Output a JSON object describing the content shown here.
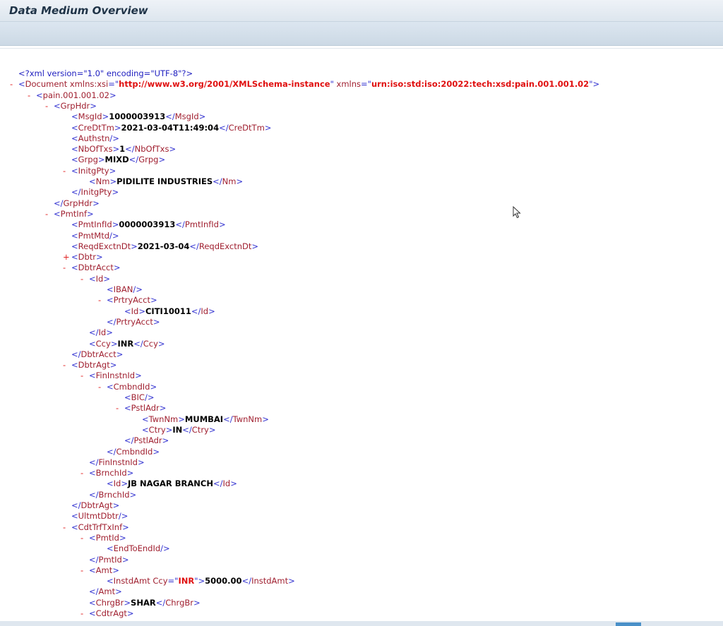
{
  "window": {
    "title": "Data Medium Overview"
  },
  "xml_lines": [
    {
      "indent": 0,
      "toggle": "",
      "parts": [
        [
          "pi",
          "<?xml version=\"1.0\" encoding=\"UTF-8\"?>"
        ]
      ]
    },
    {
      "indent": 0,
      "toggle": "-",
      "parts": [
        [
          "tag",
          "<"
        ],
        [
          "tagname",
          "Document"
        ],
        [
          "attr",
          " xmlns:xsi"
        ],
        [
          "tag",
          "=\""
        ],
        [
          "attrval",
          "http://www.w3.org/2001/XMLSchema-instance"
        ],
        [
          "tag",
          "\""
        ],
        [
          "attr",
          " xmlns"
        ],
        [
          "tag",
          "=\""
        ],
        [
          "attrval",
          "urn:iso:std:iso:20022:tech:xsd:pain.001.001.02"
        ],
        [
          "tag",
          "\">"
        ]
      ]
    },
    {
      "indent": 1,
      "toggle": "-",
      "parts": [
        [
          "tag",
          "<"
        ],
        [
          "tagname",
          "pain.001.001.02"
        ],
        [
          "tag",
          ">"
        ]
      ]
    },
    {
      "indent": 2,
      "toggle": "-",
      "parts": [
        [
          "tag",
          "<"
        ],
        [
          "tagname",
          "GrpHdr"
        ],
        [
          "tag",
          ">"
        ]
      ]
    },
    {
      "indent": 3,
      "toggle": "",
      "parts": [
        [
          "tag",
          "<"
        ],
        [
          "tagname",
          "MsgId"
        ],
        [
          "tag",
          ">"
        ],
        [
          "val",
          "1000003913"
        ],
        [
          "tag",
          "</"
        ],
        [
          "tagname",
          "MsgId"
        ],
        [
          "tag",
          ">"
        ]
      ]
    },
    {
      "indent": 3,
      "toggle": "",
      "parts": [
        [
          "tag",
          "<"
        ],
        [
          "tagname",
          "CreDtTm"
        ],
        [
          "tag",
          ">"
        ],
        [
          "val",
          "2021-03-04T11:49:04"
        ],
        [
          "tag",
          "</"
        ],
        [
          "tagname",
          "CreDtTm"
        ],
        [
          "tag",
          ">"
        ]
      ]
    },
    {
      "indent": 3,
      "toggle": "",
      "parts": [
        [
          "tag",
          "<"
        ],
        [
          "tagname",
          "Authstn"
        ],
        [
          "tag",
          "/>"
        ]
      ]
    },
    {
      "indent": 3,
      "toggle": "",
      "parts": [
        [
          "tag",
          "<"
        ],
        [
          "tagname",
          "NbOfTxs"
        ],
        [
          "tag",
          ">"
        ],
        [
          "val",
          "1"
        ],
        [
          "tag",
          "</"
        ],
        [
          "tagname",
          "NbOfTxs"
        ],
        [
          "tag",
          ">"
        ]
      ]
    },
    {
      "indent": 3,
      "toggle": "",
      "parts": [
        [
          "tag",
          "<"
        ],
        [
          "tagname",
          "Grpg"
        ],
        [
          "tag",
          ">"
        ],
        [
          "val",
          "MIXD"
        ],
        [
          "tag",
          "</"
        ],
        [
          "tagname",
          "Grpg"
        ],
        [
          "tag",
          ">"
        ]
      ]
    },
    {
      "indent": 3,
      "toggle": "-",
      "parts": [
        [
          "tag",
          "<"
        ],
        [
          "tagname",
          "InitgPty"
        ],
        [
          "tag",
          ">"
        ]
      ]
    },
    {
      "indent": 4,
      "toggle": "",
      "parts": [
        [
          "tag",
          "<"
        ],
        [
          "tagname",
          "Nm"
        ],
        [
          "tag",
          ">"
        ],
        [
          "val",
          "PIDILITE INDUSTRIES"
        ],
        [
          "tag",
          "</"
        ],
        [
          "tagname",
          "Nm"
        ],
        [
          "tag",
          ">"
        ]
      ]
    },
    {
      "indent": 3,
      "toggle": "",
      "parts": [
        [
          "tag",
          "</"
        ],
        [
          "tagname",
          "InitgPty"
        ],
        [
          "tag",
          ">"
        ]
      ]
    },
    {
      "indent": 2,
      "toggle": "",
      "parts": [
        [
          "tag",
          "</"
        ],
        [
          "tagname",
          "GrpHdr"
        ],
        [
          "tag",
          ">"
        ]
      ]
    },
    {
      "indent": 2,
      "toggle": "-",
      "parts": [
        [
          "tag",
          "<"
        ],
        [
          "tagname",
          "PmtInf"
        ],
        [
          "tag",
          ">"
        ]
      ]
    },
    {
      "indent": 3,
      "toggle": "",
      "parts": [
        [
          "tag",
          "<"
        ],
        [
          "tagname",
          "PmtInfId"
        ],
        [
          "tag",
          ">"
        ],
        [
          "val",
          "0000003913"
        ],
        [
          "tag",
          "</"
        ],
        [
          "tagname",
          "PmtInfId"
        ],
        [
          "tag",
          ">"
        ]
      ]
    },
    {
      "indent": 3,
      "toggle": "",
      "parts": [
        [
          "tag",
          "<"
        ],
        [
          "tagname",
          "PmtMtd"
        ],
        [
          "tag",
          "/>"
        ]
      ]
    },
    {
      "indent": 3,
      "toggle": "",
      "parts": [
        [
          "tag",
          "<"
        ],
        [
          "tagname",
          "ReqdExctnDt"
        ],
        [
          "tag",
          ">"
        ],
        [
          "val",
          "2021-03-04"
        ],
        [
          "tag",
          "</"
        ],
        [
          "tagname",
          "ReqdExctnDt"
        ],
        [
          "tag",
          ">"
        ]
      ]
    },
    {
      "indent": 3,
      "toggle": "+",
      "parts": [
        [
          "tag",
          "<"
        ],
        [
          "tagname",
          "Dbtr"
        ],
        [
          "tag",
          ">"
        ]
      ]
    },
    {
      "indent": 3,
      "toggle": "-",
      "parts": [
        [
          "tag",
          "<"
        ],
        [
          "tagname",
          "DbtrAcct"
        ],
        [
          "tag",
          ">"
        ]
      ]
    },
    {
      "indent": 4,
      "toggle": "-",
      "parts": [
        [
          "tag",
          "<"
        ],
        [
          "tagname",
          "Id"
        ],
        [
          "tag",
          ">"
        ]
      ]
    },
    {
      "indent": 5,
      "toggle": "",
      "parts": [
        [
          "tag",
          "<"
        ],
        [
          "tagname",
          "IBAN"
        ],
        [
          "tag",
          "/>"
        ]
      ]
    },
    {
      "indent": 5,
      "toggle": "-",
      "parts": [
        [
          "tag",
          "<"
        ],
        [
          "tagname",
          "PrtryAcct"
        ],
        [
          "tag",
          ">"
        ]
      ]
    },
    {
      "indent": 6,
      "toggle": "",
      "parts": [
        [
          "tag",
          "<"
        ],
        [
          "tagname",
          "Id"
        ],
        [
          "tag",
          ">"
        ],
        [
          "val",
          "CITI10011"
        ],
        [
          "tag",
          "</"
        ],
        [
          "tagname",
          "Id"
        ],
        [
          "tag",
          ">"
        ]
      ]
    },
    {
      "indent": 5,
      "toggle": "",
      "parts": [
        [
          "tag",
          "</"
        ],
        [
          "tagname",
          "PrtryAcct"
        ],
        [
          "tag",
          ">"
        ]
      ]
    },
    {
      "indent": 4,
      "toggle": "",
      "parts": [
        [
          "tag",
          "</"
        ],
        [
          "tagname",
          "Id"
        ],
        [
          "tag",
          ">"
        ]
      ]
    },
    {
      "indent": 4,
      "toggle": "",
      "parts": [
        [
          "tag",
          "<"
        ],
        [
          "tagname",
          "Ccy"
        ],
        [
          "tag",
          ">"
        ],
        [
          "val",
          "INR"
        ],
        [
          "tag",
          "</"
        ],
        [
          "tagname",
          "Ccy"
        ],
        [
          "tag",
          ">"
        ]
      ]
    },
    {
      "indent": 3,
      "toggle": "",
      "parts": [
        [
          "tag",
          "</"
        ],
        [
          "tagname",
          "DbtrAcct"
        ],
        [
          "tag",
          ">"
        ]
      ]
    },
    {
      "indent": 3,
      "toggle": "-",
      "parts": [
        [
          "tag",
          "<"
        ],
        [
          "tagname",
          "DbtrAgt"
        ],
        [
          "tag",
          ">"
        ]
      ]
    },
    {
      "indent": 4,
      "toggle": "-",
      "parts": [
        [
          "tag",
          "<"
        ],
        [
          "tagname",
          "FinInstnId"
        ],
        [
          "tag",
          ">"
        ]
      ]
    },
    {
      "indent": 5,
      "toggle": "-",
      "parts": [
        [
          "tag",
          "<"
        ],
        [
          "tagname",
          "CmbndId"
        ],
        [
          "tag",
          ">"
        ]
      ]
    },
    {
      "indent": 6,
      "toggle": "",
      "parts": [
        [
          "tag",
          "<"
        ],
        [
          "tagname",
          "BIC"
        ],
        [
          "tag",
          "/>"
        ]
      ]
    },
    {
      "indent": 6,
      "toggle": "-",
      "parts": [
        [
          "tag",
          "<"
        ],
        [
          "tagname",
          "PstlAdr"
        ],
        [
          "tag",
          ">"
        ]
      ]
    },
    {
      "indent": 7,
      "toggle": "",
      "parts": [
        [
          "tag",
          "<"
        ],
        [
          "tagname",
          "TwnNm"
        ],
        [
          "tag",
          ">"
        ],
        [
          "val",
          "MUMBAI"
        ],
        [
          "tag",
          "</"
        ],
        [
          "tagname",
          "TwnNm"
        ],
        [
          "tag",
          ">"
        ]
      ]
    },
    {
      "indent": 7,
      "toggle": "",
      "parts": [
        [
          "tag",
          "<"
        ],
        [
          "tagname",
          "Ctry"
        ],
        [
          "tag",
          ">"
        ],
        [
          "val",
          "IN"
        ],
        [
          "tag",
          "</"
        ],
        [
          "tagname",
          "Ctry"
        ],
        [
          "tag",
          ">"
        ]
      ]
    },
    {
      "indent": 6,
      "toggle": "",
      "parts": [
        [
          "tag",
          "</"
        ],
        [
          "tagname",
          "PstlAdr"
        ],
        [
          "tag",
          ">"
        ]
      ]
    },
    {
      "indent": 5,
      "toggle": "",
      "parts": [
        [
          "tag",
          "</"
        ],
        [
          "tagname",
          "CmbndId"
        ],
        [
          "tag",
          ">"
        ]
      ]
    },
    {
      "indent": 4,
      "toggle": "",
      "parts": [
        [
          "tag",
          "</"
        ],
        [
          "tagname",
          "FinInstnId"
        ],
        [
          "tag",
          ">"
        ]
      ]
    },
    {
      "indent": 4,
      "toggle": "-",
      "parts": [
        [
          "tag",
          "<"
        ],
        [
          "tagname",
          "BrnchId"
        ],
        [
          "tag",
          ">"
        ]
      ]
    },
    {
      "indent": 5,
      "toggle": "",
      "parts": [
        [
          "tag",
          "<"
        ],
        [
          "tagname",
          "Id"
        ],
        [
          "tag",
          ">"
        ],
        [
          "val",
          "JB NAGAR BRANCH"
        ],
        [
          "tag",
          "</"
        ],
        [
          "tagname",
          "Id"
        ],
        [
          "tag",
          ">"
        ]
      ]
    },
    {
      "indent": 4,
      "toggle": "",
      "parts": [
        [
          "tag",
          "</"
        ],
        [
          "tagname",
          "BrnchId"
        ],
        [
          "tag",
          ">"
        ]
      ]
    },
    {
      "indent": 3,
      "toggle": "",
      "parts": [
        [
          "tag",
          "</"
        ],
        [
          "tagname",
          "DbtrAgt"
        ],
        [
          "tag",
          ">"
        ]
      ]
    },
    {
      "indent": 3,
      "toggle": "",
      "parts": [
        [
          "tag",
          "<"
        ],
        [
          "tagname",
          "UltmtDbtr"
        ],
        [
          "tag",
          "/>"
        ]
      ]
    },
    {
      "indent": 3,
      "toggle": "-",
      "parts": [
        [
          "tag",
          "<"
        ],
        [
          "tagname",
          "CdtTrfTxInf"
        ],
        [
          "tag",
          ">"
        ]
      ]
    },
    {
      "indent": 4,
      "toggle": "-",
      "parts": [
        [
          "tag",
          "<"
        ],
        [
          "tagname",
          "PmtId"
        ],
        [
          "tag",
          ">"
        ]
      ]
    },
    {
      "indent": 5,
      "toggle": "",
      "parts": [
        [
          "tag",
          "<"
        ],
        [
          "tagname",
          "EndToEndId"
        ],
        [
          "tag",
          "/>"
        ]
      ]
    },
    {
      "indent": 4,
      "toggle": "",
      "parts": [
        [
          "tag",
          "</"
        ],
        [
          "tagname",
          "PmtId"
        ],
        [
          "tag",
          ">"
        ]
      ]
    },
    {
      "indent": 4,
      "toggle": "-",
      "parts": [
        [
          "tag",
          "<"
        ],
        [
          "tagname",
          "Amt"
        ],
        [
          "tag",
          ">"
        ]
      ]
    },
    {
      "indent": 5,
      "toggle": "",
      "parts": [
        [
          "tag",
          "<"
        ],
        [
          "tagname",
          "InstdAmt"
        ],
        [
          "attr",
          " Ccy"
        ],
        [
          "tag",
          "=\""
        ],
        [
          "attrval",
          "INR"
        ],
        [
          "tag",
          "\">"
        ],
        [
          "val",
          "5000.00"
        ],
        [
          "tag",
          "</"
        ],
        [
          "tagname",
          "InstdAmt"
        ],
        [
          "tag",
          ">"
        ]
      ]
    },
    {
      "indent": 4,
      "toggle": "",
      "parts": [
        [
          "tag",
          "</"
        ],
        [
          "tagname",
          "Amt"
        ],
        [
          "tag",
          ">"
        ]
      ]
    },
    {
      "indent": 4,
      "toggle": "",
      "parts": [
        [
          "tag",
          "<"
        ],
        [
          "tagname",
          "ChrgBr"
        ],
        [
          "tag",
          ">"
        ],
        [
          "val",
          "SHAR"
        ],
        [
          "tag",
          "</"
        ],
        [
          "tagname",
          "ChrgBr"
        ],
        [
          "tag",
          ">"
        ]
      ]
    },
    {
      "indent": 4,
      "toggle": "-",
      "parts": [
        [
          "tag",
          "<"
        ],
        [
          "tagname",
          "CdtrAgt"
        ],
        [
          "tag",
          ">"
        ]
      ]
    }
  ]
}
